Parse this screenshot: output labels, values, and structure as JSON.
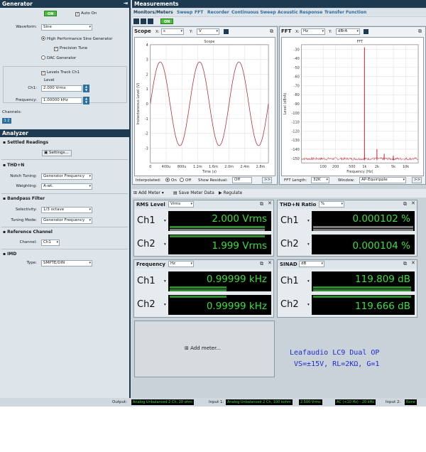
{
  "generator": {
    "title": "Generator",
    "on_label": "ON",
    "auto_on": "Auto On",
    "waveform_label": "Waveform:",
    "waveform_value": "Sine",
    "hp_sine": "High Performance Sine Generator",
    "precision_tune": "Precision Tune",
    "dac": "DAC Generator",
    "levels_track": "Levels Track Ch1",
    "level_label": "Level",
    "ch1_label": "Ch1:",
    "ch1_value": "2.000 Vrms",
    "freq_label": "Frequency:",
    "freq_value": "1.00000 kHz",
    "channels_label": "Channels:",
    "channels_btn": "1 2"
  },
  "analyzer": {
    "title": "Analyzer",
    "settled": "Settled Readings",
    "settings_btn": "Settings...",
    "thdn": "THD+N",
    "notch_label": "Notch Tuning:",
    "notch_value": "Generator Frequency",
    "weight_label": "Weighting:",
    "weight_value": "A-wt.",
    "bandpass": "Bandpass Filter",
    "sel_label": "Selectivity:",
    "sel_value": "1/3 octave",
    "tuning_label": "Tuning Mode:",
    "tuning_value": "Generator Frequency",
    "ref": "Reference Channel",
    "channel_label": "Channel:",
    "channel_value": "Ch1",
    "imd": "IMD",
    "type_label": "Type:",
    "type_value": "SMPTE/DIN"
  },
  "measurements": {
    "title": "Measurements",
    "tabs": [
      "Monitors/Meters",
      "Sweep",
      "FFT",
      "Recorder",
      "Continuous Sweep",
      "Acoustic Response",
      "Transfer Function"
    ],
    "on_label": "ON"
  },
  "scope": {
    "title": "Scope",
    "x_label": "X:",
    "x_unit": "s",
    "y_label": "Y:",
    "y_unit": "V",
    "interp_label": "Interpolated:",
    "on": "On",
    "off": "Off",
    "residual_label": "Show Residual:",
    "residual_value": "Off",
    "more": ">>"
  },
  "fft": {
    "title": "FFT",
    "x_label": "X:",
    "x_unit": "Hz",
    "y_label": "Y:",
    "y_unit": "dBrA",
    "length_label": "FFT Length:",
    "length_value": "32K",
    "window_label": "Window:",
    "window_value": "AP-Equiripple",
    "more": ">>"
  },
  "toolbar": {
    "add_meter": "Add Meter",
    "save": "Save Meter Data",
    "regulate": "Regulate"
  },
  "meters": {
    "rms": {
      "title": "RMS Level",
      "unit": "Vrms",
      "ch1_name": "Ch1",
      "ch2_name": "Ch2",
      "ch1": "2.000  Vrms",
      "ch2": "1.999  Vrms",
      "ch1_level": 0.95,
      "ch2_level": 0.95
    },
    "thdn": {
      "title": "THD+N Ratio",
      "unit": "%",
      "ch1_name": "Ch1",
      "ch2_name": "Ch2",
      "ch1": "0.000102  %",
      "ch2": "0.000104  %",
      "ch1_level": 0.0,
      "ch2_level": 0.0
    },
    "freq": {
      "title": "Frequency",
      "unit": "Hz",
      "ch1_name": "Ch1",
      "ch2_name": "Ch2",
      "ch1": "0.99999  kHz",
      "ch2": "0.99999  kHz",
      "ch1_level": 0.57,
      "ch2_level": 0.57
    },
    "sinad": {
      "title": "SINAD",
      "unit": "dB",
      "ch1_name": "Ch1",
      "ch2_name": "Ch2",
      "ch1": "119.809  dB",
      "ch2": "119.666  dB",
      "ch1_level": 0.98,
      "ch2_level": 0.98
    }
  },
  "add_meter_big": "Add meter...",
  "note": {
    "line1": "Leafaudio LC9   Dual OP",
    "line2": "VS=±15V, RL=2KΩ, G=1"
  },
  "status": {
    "output_label": "Output:",
    "output_value": "Analog Unbalanced 2 Ch, 20 ohm",
    "input1_label": "Input 1:",
    "input1_value": "Analog Unbalanced 2 Ch, 100 kohm",
    "input1_level": "2.500 Vrms",
    "input1_coupling": "AC (<10 Hz) - 20 kHz",
    "input2_label": "Input 2:",
    "input2_value": "None"
  },
  "chart_data": [
    {
      "type": "line",
      "title": "Scope",
      "xlabel": "Time (s)",
      "ylabel": "Instantaneous Level (V)",
      "x_ticks": [
        "0",
        "400u",
        "800u",
        "1.2m",
        "1.6m",
        "2.0m",
        "2.4m",
        "2.8m"
      ],
      "y_ticks": [
        "-3",
        "-2",
        "-1",
        "0",
        "1",
        "2",
        "3",
        "4"
      ],
      "xlim": [
        0,
        0.003
      ],
      "ylim": [
        -4,
        4
      ],
      "series": [
        {
          "frequency_hz": 1000,
          "amplitude_v": 2.83,
          "color": "#b03040"
        }
      ]
    },
    {
      "type": "line",
      "title": "FFT",
      "xlabel": "Frequency (Hz)",
      "ylabel": "Level (dBrA)",
      "x_ticks": [
        "100",
        "200",
        "500",
        "1k",
        "2k",
        "5k",
        "10k"
      ],
      "y_ticks": [
        "-30",
        "-40",
        "-50",
        "-60",
        "-70",
        "-80",
        "-90",
        "-100",
        "-110",
        "-120",
        "-130",
        "-140",
        "-150"
      ],
      "xlim": [
        30,
        20000
      ],
      "ylim": [
        -155,
        -25
      ],
      "series": [
        {
          "color": "#c02030",
          "peaks": [
            [
              1000,
              -28
            ],
            [
              2000,
              -140
            ],
            [
              3000,
              -145
            ],
            [
              5000,
              -147
            ]
          ],
          "noise_floor_db": -152
        }
      ]
    }
  ]
}
